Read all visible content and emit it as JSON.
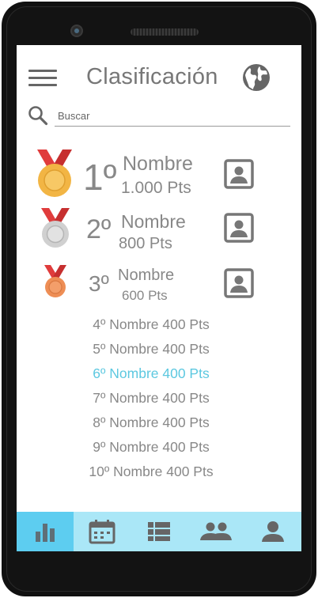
{
  "header": {
    "title": "Clasificación"
  },
  "search": {
    "placeholder": "Buscar"
  },
  "podium": [
    {
      "rank": "1º",
      "name": "Nombre",
      "points": "1.000 Pts",
      "medal": "gold-medal-icon"
    },
    {
      "rank": "2º",
      "name": "Nombre",
      "points": "800 Pts",
      "medal": "silver-medal-icon"
    },
    {
      "rank": "3º",
      "name": "Nombre",
      "points": "600 Pts",
      "medal": "bronze-medal-icon"
    }
  ],
  "ranking": [
    {
      "text": "4º Nombre 400 Pts",
      "highlight": false
    },
    {
      "text": "5º Nombre 400 Pts",
      "highlight": false
    },
    {
      "text": "6º Nombre 400 Pts",
      "highlight": true
    },
    {
      "text": "7º Nombre 400 Pts",
      "highlight": false
    },
    {
      "text": "8º Nombre 400 Pts",
      "highlight": false
    },
    {
      "text": "9º Nombre 400 Pts",
      "highlight": false
    },
    {
      "text": "10º Nombre 400 Pts",
      "highlight": false
    }
  ],
  "nav": [
    {
      "icon": "bar-chart-icon",
      "active": true
    },
    {
      "icon": "calendar-icon",
      "active": false
    },
    {
      "icon": "list-icon",
      "active": false
    },
    {
      "icon": "group-icon",
      "active": false
    },
    {
      "icon": "person-icon",
      "active": false
    }
  ],
  "colors": {
    "accent": "#5dcdf0",
    "nav_bg": "#aae7f7",
    "highlight_text": "#5cc8e0",
    "gold": "#f2b544",
    "silver": "#cccccc",
    "bronze": "#ee8e55",
    "ribbon": "#e03c3c"
  }
}
